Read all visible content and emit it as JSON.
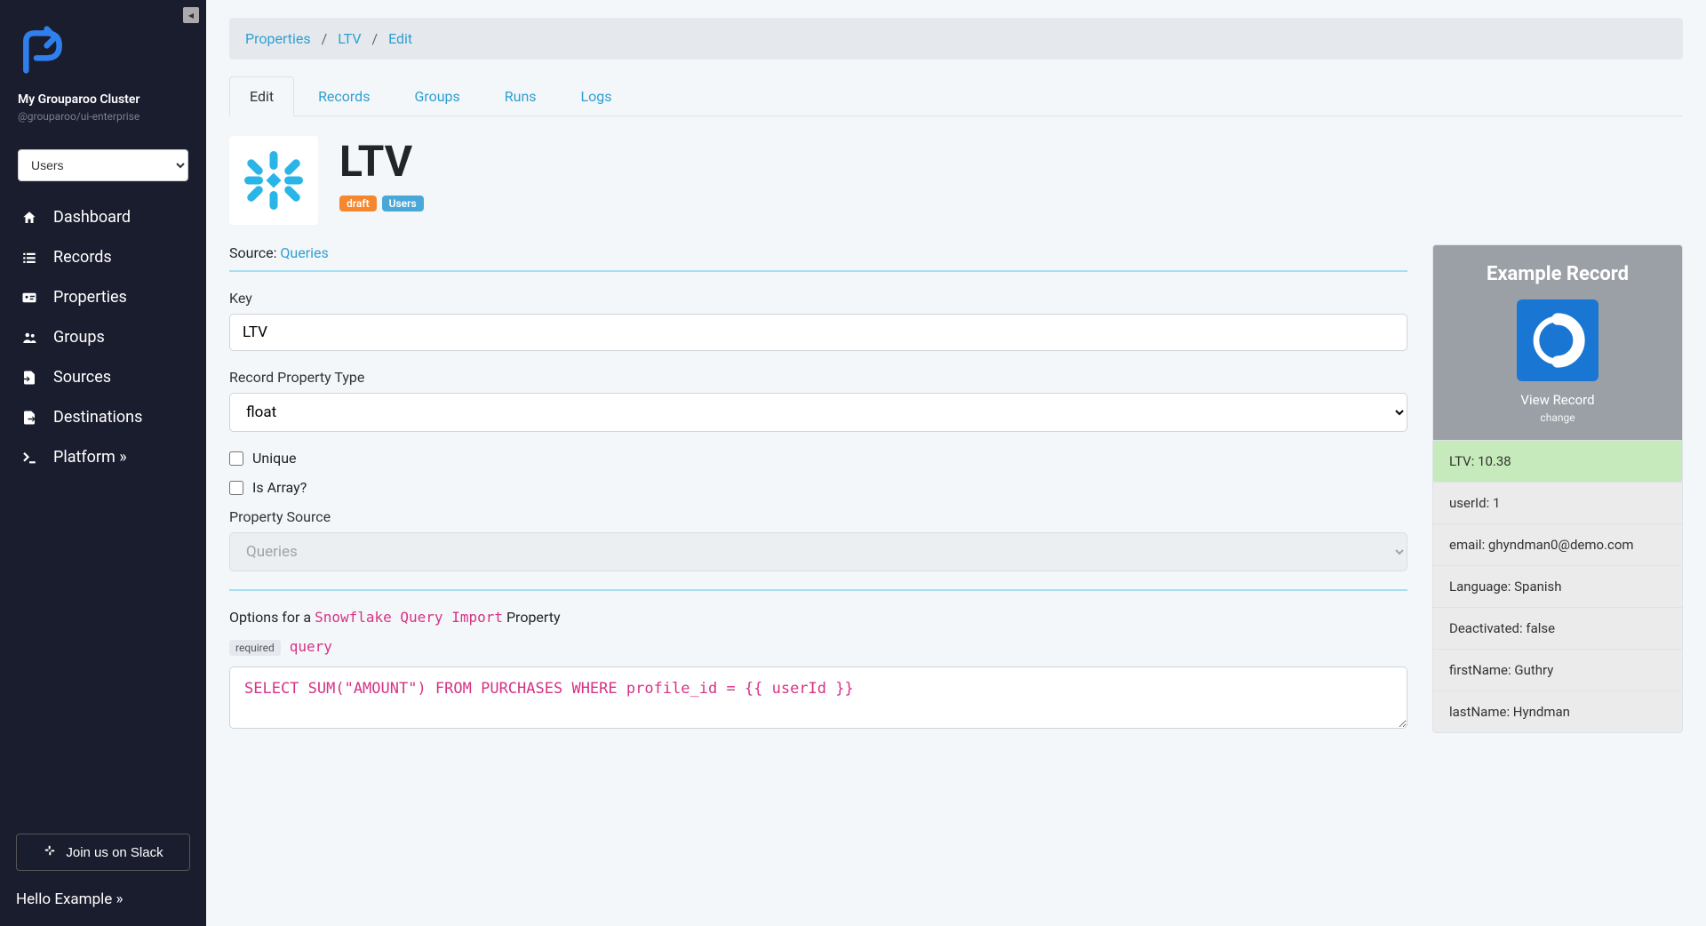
{
  "cluster": {
    "name": "My Grouparoo Cluster",
    "sub": "@grouparoo/ui-enterprise"
  },
  "modelSelect": {
    "value": "Users"
  },
  "nav": [
    {
      "label": "Dashboard"
    },
    {
      "label": "Records"
    },
    {
      "label": "Properties"
    },
    {
      "label": "Groups"
    },
    {
      "label": "Sources"
    },
    {
      "label": "Destinations"
    },
    {
      "label": "Platform »"
    }
  ],
  "slackBtn": "Join us on Slack",
  "helloUser": "Hello Example »",
  "breadcrumb": {
    "a": "Properties",
    "b": "LTV",
    "c": "Edit"
  },
  "tabs": [
    {
      "label": "Edit",
      "active": true
    },
    {
      "label": "Records"
    },
    {
      "label": "Groups"
    },
    {
      "label": "Runs"
    },
    {
      "label": "Logs"
    }
  ],
  "page": {
    "title": "LTV",
    "badges": {
      "draft": "draft",
      "model": "Users"
    },
    "sourceLabel": "Source:",
    "sourceLink": "Queries"
  },
  "form": {
    "keyLabel": "Key",
    "keyValue": "LTV",
    "typeLabel": "Record Property Type",
    "typeValue": "float",
    "uniqueLabel": "Unique",
    "arrayLabel": "Is Array?",
    "sourceSelLabel": "Property Source",
    "sourceSelValue": "Queries",
    "optionsPrefix": "Options for a ",
    "optionsImport": "Snowflake Query Import",
    "optionsSuffix": " Property",
    "reqBadge": "required",
    "queryWord": "query",
    "queryValue": "SELECT SUM(\"AMOUNT\") FROM PURCHASES WHERE profile_id = {{ userId }}"
  },
  "example": {
    "heading": "Example Record",
    "viewLabel": "View Record",
    "changeLabel": "change",
    "rows": [
      {
        "key": "LTV",
        "val": "10.38",
        "active": true
      },
      {
        "key": "userId",
        "val": "1"
      },
      {
        "key": "email",
        "val": "ghyndman0@demo.com"
      },
      {
        "key": "Language",
        "val": "Spanish"
      },
      {
        "key": "Deactivated",
        "val": "false"
      },
      {
        "key": "firstName",
        "val": "Guthry"
      },
      {
        "key": "lastName",
        "val": "Hyndman"
      }
    ]
  }
}
